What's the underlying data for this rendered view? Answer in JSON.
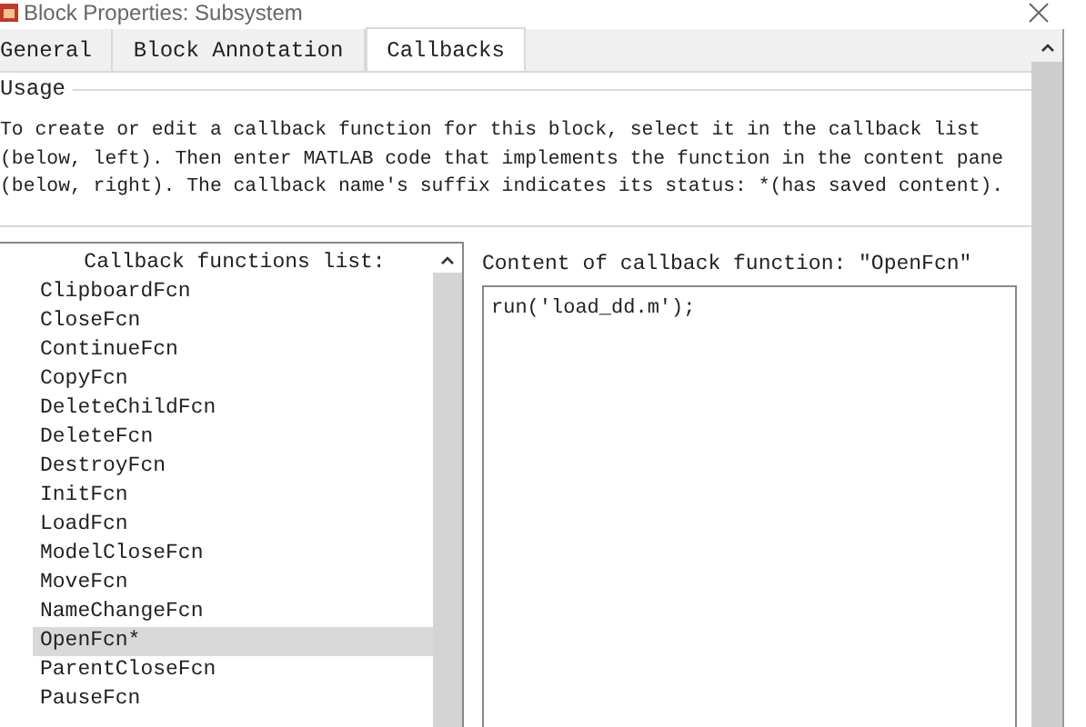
{
  "window": {
    "title": "Block Properties: Subsystem"
  },
  "tabs": [
    {
      "label": "General",
      "selected": false
    },
    {
      "label": "Block Annotation",
      "selected": false
    },
    {
      "label": "Callbacks",
      "selected": true
    }
  ],
  "usage": {
    "legend": "Usage",
    "lines": [
      "To create or edit a callback function for this block, select it in the callback list",
      "(below, left). Then enter MATLAB code that implements the function in the content pane",
      "(below, right). The callback name's suffix indicates its status: *(has saved content)."
    ]
  },
  "callback_list": {
    "heading": "Callback functions list:",
    "items": [
      {
        "label": "ClipboardFcn",
        "selected": false
      },
      {
        "label": "CloseFcn",
        "selected": false
      },
      {
        "label": "ContinueFcn",
        "selected": false
      },
      {
        "label": "CopyFcn",
        "selected": false
      },
      {
        "label": "DeleteChildFcn",
        "selected": false
      },
      {
        "label": "DeleteFcn",
        "selected": false
      },
      {
        "label": "DestroyFcn",
        "selected": false
      },
      {
        "label": "InitFcn",
        "selected": false
      },
      {
        "label": "LoadFcn",
        "selected": false
      },
      {
        "label": "ModelCloseFcn",
        "selected": false
      },
      {
        "label": "MoveFcn",
        "selected": false
      },
      {
        "label": "NameChangeFcn",
        "selected": false
      },
      {
        "label": "OpenFcn*",
        "selected": true
      },
      {
        "label": "ParentCloseFcn",
        "selected": false
      },
      {
        "label": "PauseFcn",
        "selected": false
      }
    ]
  },
  "content": {
    "label": "Content of callback function: \"OpenFcn\"",
    "value": "run('load_dd.m');"
  }
}
